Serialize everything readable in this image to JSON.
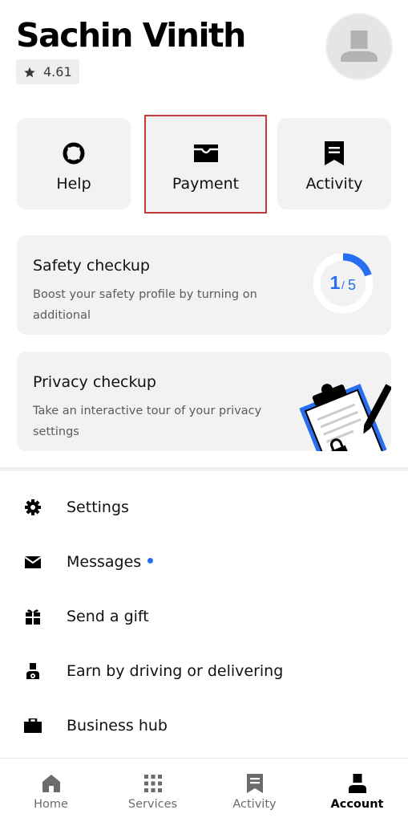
{
  "profile": {
    "name": "Sachin Vinith",
    "rating": "4.61"
  },
  "tiles": {
    "help": "Help",
    "payment": "Payment",
    "activity": "Activity"
  },
  "safety_card": {
    "title": "Safety checkup",
    "description": "Boost your safety profile by turning on additional",
    "progress_current": "1",
    "progress_total": "5",
    "progress_fraction": 0.2
  },
  "privacy_card": {
    "title": "Privacy checkup",
    "description": "Take an interactive tour of your privacy settings"
  },
  "menu": {
    "items": [
      {
        "label": "Settings",
        "icon": "gear-icon"
      },
      {
        "label": "Messages",
        "icon": "envelope-icon",
        "unread_dot": true
      },
      {
        "label": "Send a gift",
        "icon": "gift-icon"
      },
      {
        "label": "Earn by driving or delivering",
        "icon": "driver-icon"
      },
      {
        "label": "Business hub",
        "icon": "briefcase-icon"
      }
    ]
  },
  "bottom_nav": {
    "items": [
      {
        "label": "Home",
        "icon": "home-icon",
        "active": false
      },
      {
        "label": "Services",
        "icon": "grid-icon",
        "active": false
      },
      {
        "label": "Activity",
        "icon": "receipt-icon",
        "active": false
      },
      {
        "label": "Account",
        "icon": "person-icon",
        "active": true
      }
    ]
  },
  "colors": {
    "accent_blue": "#276ef1",
    "highlight_border": "#c43a3a",
    "card_background": "#f2f2f2"
  }
}
